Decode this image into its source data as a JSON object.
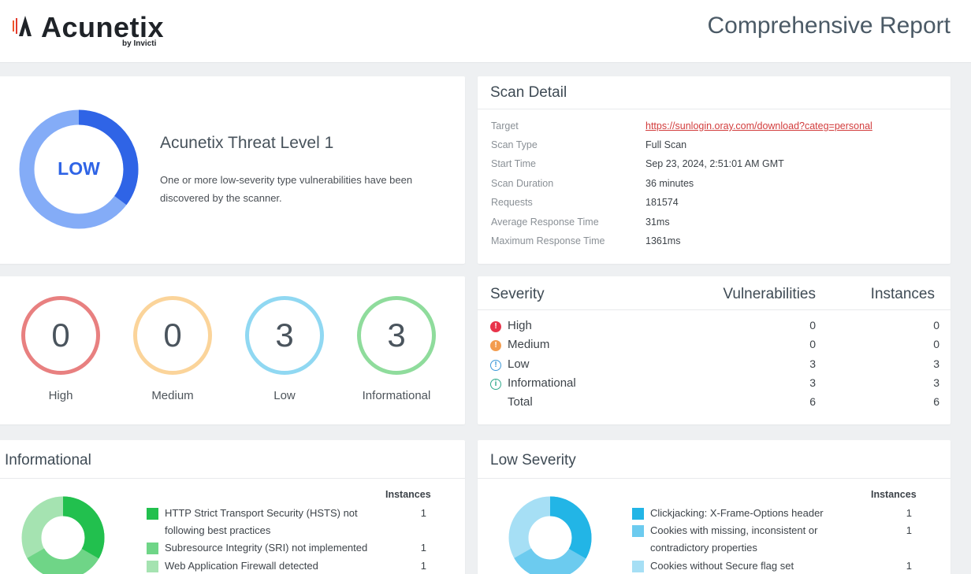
{
  "header": {
    "brand": "Acunetix",
    "brand_sub": "by Invicti",
    "report_title": "Comprehensive Report"
  },
  "threat": {
    "level_label": "LOW",
    "title": "Acunetix Threat Level 1",
    "description": "One or more low-severity type vulnerabilities have been discovered by the scanner."
  },
  "scan_detail": {
    "heading": "Scan Detail",
    "rows": [
      {
        "key": "Target",
        "value": "https://sunlogin.oray.com/download?categ=personal"
      },
      {
        "key": "Scan Type",
        "value": "Full Scan"
      },
      {
        "key": "Start Time",
        "value": "Sep 23, 2024, 2:51:01 AM GMT"
      },
      {
        "key": "Scan Duration",
        "value": "36 minutes"
      },
      {
        "key": "Requests",
        "value": "181574"
      },
      {
        "key": "Average Response Time",
        "value": "31ms"
      },
      {
        "key": "Maximum Response Time",
        "value": "1361ms"
      }
    ]
  },
  "counters": [
    {
      "label": "High",
      "value": "0",
      "color": "#e88080"
    },
    {
      "label": "Medium",
      "value": "0",
      "color": "#fbd49a"
    },
    {
      "label": "Low",
      "value": "3",
      "color": "#90d8f2"
    },
    {
      "label": "Informational",
      "value": "3",
      "color": "#8fdc9c"
    }
  ],
  "severity": {
    "col_severity": "Severity",
    "col_vulns": "Vulnerabilities",
    "col_instances": "Instances",
    "rows": [
      {
        "name": "High",
        "vulns": "0",
        "instances": "0",
        "icon": "high-alert-icon",
        "color": "#e8334a"
      },
      {
        "name": "Medium",
        "vulns": "0",
        "instances": "0",
        "icon": "medium-alert-icon",
        "color": "#f39c4e"
      },
      {
        "name": "Low",
        "vulns": "3",
        "instances": "3",
        "icon": "low-alert-icon",
        "color": "#3c98d8"
      },
      {
        "name": "Informational",
        "vulns": "3",
        "instances": "3",
        "icon": "info-icon",
        "color": "#2fa98b"
      },
      {
        "name": "Total",
        "vulns": "6",
        "instances": "6"
      }
    ]
  },
  "informational": {
    "heading": "Informational",
    "instances_label": "Instances",
    "items": [
      {
        "name": "HTTP Strict Transport Security (HSTS) not following best practices",
        "count": "1",
        "color": "#22c04e"
      },
      {
        "name": "Subresource Integrity (SRI) not implemented",
        "count": "1",
        "color": "#6fd587"
      },
      {
        "name": "Web Application Firewall detected",
        "count": "1",
        "color": "#a5e3b1"
      }
    ]
  },
  "low_severity": {
    "heading": "Low Severity",
    "instances_label": "Instances",
    "items": [
      {
        "name": "Clickjacking: X-Frame-Options header",
        "count": "1",
        "color": "#22b5e6"
      },
      {
        "name": "Cookies with missing, inconsistent or contradictory properties",
        "count": "1",
        "color": "#6ccbef"
      },
      {
        "name": "Cookies without Secure flag set",
        "count": "1",
        "color": "#a6dff5"
      }
    ]
  },
  "colors": {
    "threat_dark": "#2f64e6",
    "threat_light": "#84acf7",
    "link": "#d23c3c"
  }
}
